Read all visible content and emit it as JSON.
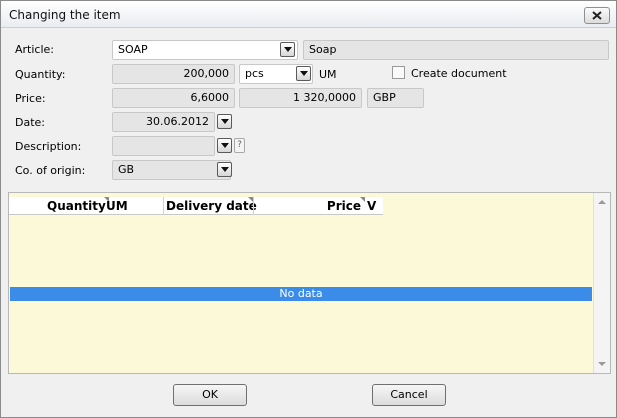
{
  "window": {
    "title": "Changing the item"
  },
  "form": {
    "article": {
      "label": "Article:",
      "code": "SOAP",
      "name": "Soap"
    },
    "quantity": {
      "label": "Quantity:",
      "value": "200,000",
      "unit": "pcs",
      "unit_label": "UM"
    },
    "create_document": {
      "label": "Create document",
      "checked": false
    },
    "price": {
      "label": "Price:",
      "value": "6,6000",
      "total": "1 320,0000",
      "currency": "GBP"
    },
    "date": {
      "label": "Date:",
      "value": "30.06.2012"
    },
    "description": {
      "label": "Description:",
      "value": "",
      "help": "?"
    },
    "origin": {
      "label": "Co. of origin:",
      "value": "GB"
    }
  },
  "grid": {
    "columns": [
      "Quantity",
      "UM",
      "Delivery date",
      "Price",
      "V"
    ],
    "rows": [],
    "empty_text": "No data"
  },
  "buttons": {
    "ok": "OK",
    "cancel": "Cancel"
  },
  "icons": {
    "close": "close-icon",
    "dropdown": "chevron-down-icon"
  }
}
